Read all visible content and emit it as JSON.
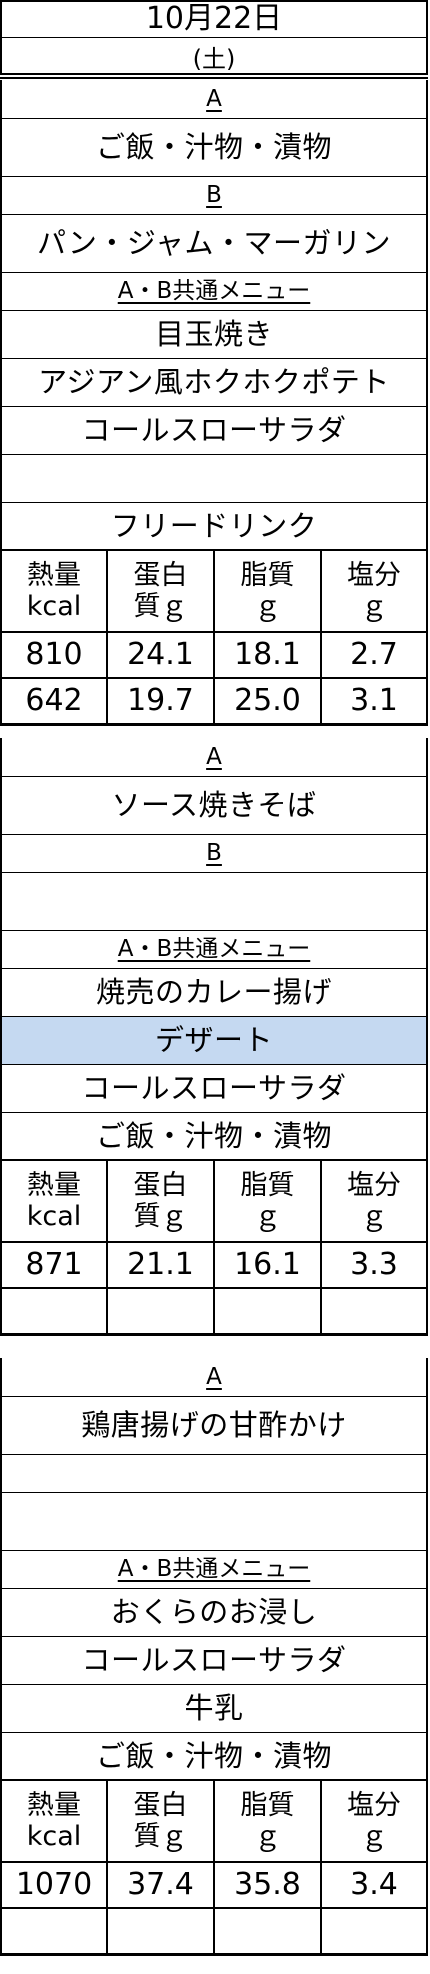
{
  "header": {
    "date": "10月22日",
    "weekday": "(土)"
  },
  "sections": [
    {
      "rows": [
        {
          "id": "s1-a-label",
          "text": "A",
          "kind": "label"
        },
        {
          "id": "s1-a-item1",
          "text": "ご飯・汁物・漬物",
          "kind": "text"
        },
        {
          "id": "s1-b-label",
          "text": "B",
          "kind": "label"
        },
        {
          "id": "s1-b-item1",
          "text": "パン・ジャム・マーガリン",
          "kind": "text"
        },
        {
          "id": "s1-common-label",
          "text": "A・B共通メニュー",
          "kind": "label"
        },
        {
          "id": "s1-common-item1",
          "text": "目玉焼き",
          "kind": "text"
        },
        {
          "id": "s1-common-item2",
          "text": "アジアン風ホクホクポテト",
          "kind": "text"
        },
        {
          "id": "s1-common-item3",
          "text": "コールスローサラダ",
          "kind": "text"
        },
        {
          "id": "s1-common-item4",
          "text": "",
          "kind": "text"
        },
        {
          "id": "s1-common-item5",
          "text": "フリードリンク",
          "kind": "text"
        }
      ],
      "nutrition": {
        "headers": [
          [
            "熱量",
            "kcal"
          ],
          [
            "蛋白",
            "質ｇ"
          ],
          [
            "脂質",
            "ｇ"
          ],
          [
            "塩分",
            "ｇ"
          ]
        ],
        "values": [
          [
            "810",
            "24.1",
            "18.1",
            "2.7"
          ],
          [
            "642",
            "19.7",
            "25.0",
            "3.1"
          ]
        ]
      }
    },
    {
      "rows": [
        {
          "id": "s2-a-label",
          "text": "A",
          "kind": "label"
        },
        {
          "id": "s2-a-item1",
          "text": "ソース焼きそば",
          "kind": "text"
        },
        {
          "id": "s2-b-label",
          "text": "B",
          "kind": "label"
        },
        {
          "id": "s2-b-item1",
          "text": "",
          "kind": "text"
        },
        {
          "id": "s2-common-label",
          "text": "A・B共通メニュー",
          "kind": "label"
        },
        {
          "id": "s2-common-item1",
          "text": "焼売のカレー揚げ",
          "kind": "text"
        },
        {
          "id": "s2-common-item2",
          "text": "デザート",
          "kind": "text",
          "highlight": "#c5d9f1"
        },
        {
          "id": "s2-common-item3",
          "text": "コールスローサラダ",
          "kind": "text"
        },
        {
          "id": "s2-common-item4",
          "text": "ご飯・汁物・漬物",
          "kind": "text"
        }
      ],
      "nutrition": {
        "headers": [
          [
            "熱量",
            "kcal"
          ],
          [
            "蛋白",
            "質ｇ"
          ],
          [
            "脂質",
            "ｇ"
          ],
          [
            "塩分",
            "ｇ"
          ]
        ],
        "values": [
          [
            "871",
            "21.1",
            "16.1",
            "3.3"
          ],
          [
            "",
            "",
            "",
            ""
          ]
        ]
      }
    },
    {
      "rows": [
        {
          "id": "s3-a-label",
          "text": "A",
          "kind": "label"
        },
        {
          "id": "s3-a-item1",
          "text": "鶏唐揚げの甘酢かけ",
          "kind": "text"
        },
        {
          "id": "s3-b-label",
          "text": "",
          "kind": "label"
        },
        {
          "id": "s3-b-item1",
          "text": "",
          "kind": "text"
        },
        {
          "id": "s3-common-label",
          "text": "A・B共通メニュー",
          "kind": "label"
        },
        {
          "id": "s3-common-item1",
          "text": "おくらのお浸し",
          "kind": "text"
        },
        {
          "id": "s3-common-item2",
          "text": "コールスローサラダ",
          "kind": "text"
        },
        {
          "id": "s3-common-item3",
          "text": "牛乳",
          "kind": "text"
        },
        {
          "id": "s3-common-item4",
          "text": "ご飯・汁物・漬物",
          "kind": "text"
        }
      ],
      "nutrition": {
        "headers": [
          [
            "熱量",
            "kcal"
          ],
          [
            "蛋白",
            "質ｇ"
          ],
          [
            "脂質",
            "ｇ"
          ],
          [
            "塩分",
            "ｇ"
          ]
        ],
        "values": [
          [
            "1070",
            "37.4",
            "35.8",
            "3.4"
          ],
          [
            "",
            "",
            "",
            ""
          ]
        ]
      }
    }
  ]
}
